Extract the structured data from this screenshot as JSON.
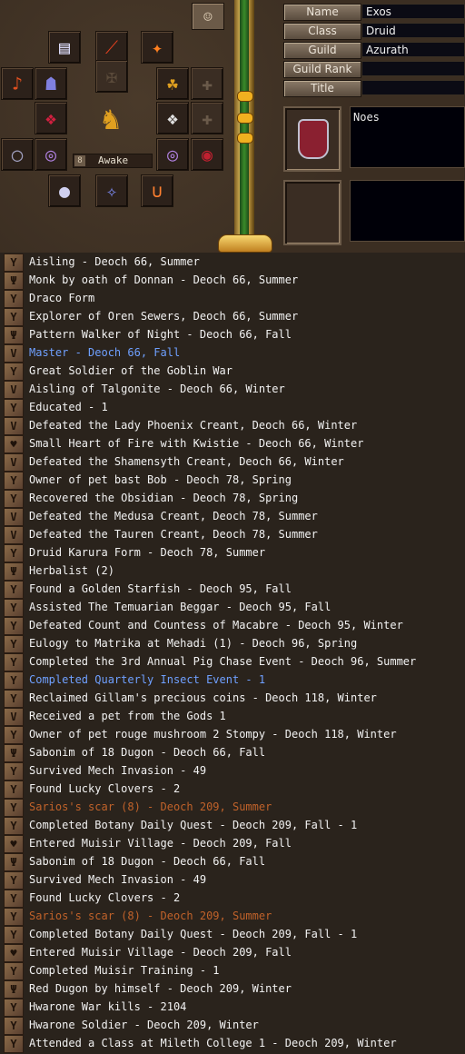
{
  "colors": {
    "white": "#f2f2f2",
    "blue": "#6fa0ff",
    "orange": "#c0622a",
    "label_bg": "#6b5a48",
    "field_bg": "#0b0b14"
  },
  "equipment": {
    "state_number": "8",
    "state_label": "Awake",
    "slots": [
      {
        "icon": "white-armor-icon",
        "glyph": "▤",
        "color": "#e0e0ff"
      },
      {
        "icon": "dagger-icon",
        "glyph": "⟋",
        "color": "#e04020"
      },
      {
        "icon": "flame-staff-icon",
        "glyph": "✦",
        "color": "#ff8020"
      },
      {
        "icon": "red-boot-icon",
        "glyph": "♪",
        "color": "#e05020"
      },
      {
        "icon": "blue-gauntlet-icon",
        "glyph": "☗",
        "color": "#8080e0"
      },
      {
        "icon": "empty-helm-slot-icon",
        "glyph": "✠",
        "color": "#5a4a3a"
      },
      {
        "icon": "fox-companion-icon",
        "glyph": "☘",
        "color": "#e0a020"
      },
      {
        "icon": "empty-ring-slot-icon",
        "glyph": "✚",
        "color": "#6a5a4a"
      },
      {
        "icon": "red-wings-icon",
        "glyph": "❖",
        "color": "#d02040"
      },
      {
        "icon": "white-wings-icon",
        "glyph": "❖",
        "color": "#e0e0e0"
      },
      {
        "icon": "empty-accessory-slot-icon",
        "glyph": "✚",
        "color": "#6a5a4a"
      },
      {
        "icon": "dark-ring-icon",
        "glyph": "◯",
        "color": "#a0a0c0"
      },
      {
        "icon": "purple-bracelet-icon",
        "glyph": "◎",
        "color": "#b080e0"
      },
      {
        "icon": "purple-bracelet-icon",
        "glyph": "◎",
        "color": "#b080e0"
      },
      {
        "icon": "red-gem-ring-icon",
        "glyph": "◉",
        "color": "#c02030"
      },
      {
        "icon": "silver-orb-icon",
        "glyph": "●",
        "color": "#d0d0f0"
      },
      {
        "icon": "small-charm-icon",
        "glyph": "✧",
        "color": "#8090ff"
      },
      {
        "icon": "orange-necklace-icon",
        "glyph": "∪",
        "color": "#ff8030"
      }
    ]
  },
  "profile": {
    "name_label": "Name",
    "name_value": "Exos",
    "class_label": "Class",
    "class_value": "Druid",
    "guild_label": "Guild",
    "guild_value": "Azurath",
    "guild_rank_label": "Guild Rank",
    "guild_rank_value": "",
    "title_label": "Title",
    "title_value": "",
    "message": "Noes",
    "message2": ""
  },
  "legend_marks": [
    {
      "text": "Aisling - Deoch 66, Summer",
      "color": "white",
      "icon": "aisling-mark-icon",
      "glyph": "Y"
    },
    {
      "text": "Monk by oath of Donnan - Deoch 66, Summer",
      "color": "white",
      "icon": "fist-mark-icon",
      "glyph": "Ψ"
    },
    {
      "text": "Draco Form",
      "color": "white",
      "icon": "aisling-mark-icon",
      "glyph": "Y"
    },
    {
      "text": "Explorer of Oren Sewers, Deoch 66, Summer",
      "color": "white",
      "icon": "aisling-mark-icon",
      "glyph": "Y"
    },
    {
      "text": "Pattern Walker of Night - Deoch 66, Fall",
      "color": "white",
      "icon": "fist-mark-icon",
      "glyph": "Ψ"
    },
    {
      "text": "Master - Deoch 66, Fall",
      "color": "blue",
      "icon": "check-mark-icon",
      "glyph": "V"
    },
    {
      "text": "Great Soldier of the Goblin War",
      "color": "white",
      "icon": "aisling-mark-icon",
      "glyph": "Y"
    },
    {
      "text": "Aisling of Talgonite - Deoch 66, Winter",
      "color": "white",
      "icon": "check-mark-icon",
      "glyph": "V"
    },
    {
      "text": "Educated - 1",
      "color": "white",
      "icon": "aisling-mark-icon",
      "glyph": "Y"
    },
    {
      "text": "Defeated the Lady Phoenix Creant, Deoch 66, Winter",
      "color": "white",
      "icon": "check-mark-icon",
      "glyph": "V"
    },
    {
      "text": "Small Heart of Fire with Kwistie - Deoch 66, Winter",
      "color": "white",
      "icon": "heart-mark-icon",
      "glyph": "♥"
    },
    {
      "text": "Defeated the Shamensyth Creant, Deoch 66, Winter",
      "color": "white",
      "icon": "check-mark-icon",
      "glyph": "V"
    },
    {
      "text": "Owner of pet bast Bob - Deoch 78, Spring",
      "color": "white",
      "icon": "aisling-mark-icon",
      "glyph": "Y"
    },
    {
      "text": "Recovered the Obsidian - Deoch 78, Spring",
      "color": "white",
      "icon": "aisling-mark-icon",
      "glyph": "Y"
    },
    {
      "text": "Defeated the Medusa Creant, Deoch 78, Summer",
      "color": "white",
      "icon": "check-mark-icon",
      "glyph": "V"
    },
    {
      "text": "Defeated the Tauren Creant, Deoch 78, Summer",
      "color": "white",
      "icon": "check-mark-icon",
      "glyph": "V"
    },
    {
      "text": "Druid Karura Form - Deoch 78, Summer",
      "color": "white",
      "icon": "aisling-mark-icon",
      "glyph": "Y"
    },
    {
      "text": "Herbalist (2)",
      "color": "white",
      "icon": "fist-mark-icon",
      "glyph": "Ψ"
    },
    {
      "text": "Found a Golden Starfish - Deoch 95, Fall",
      "color": "white",
      "icon": "aisling-mark-icon",
      "glyph": "Y"
    },
    {
      "text": "Assisted The Temuarian Beggar - Deoch 95, Fall",
      "color": "white",
      "icon": "aisling-mark-icon",
      "glyph": "Y"
    },
    {
      "text": "Defeated Count and Countess of Macabre - Deoch 95, Winter",
      "color": "white",
      "icon": "aisling-mark-icon",
      "glyph": "Y"
    },
    {
      "text": "Eulogy to Matrika at Mehadi (1) - Deoch 96, Spring",
      "color": "white",
      "icon": "aisling-mark-icon",
      "glyph": "Y"
    },
    {
      "text": "Completed the 3rd Annual Pig Chase Event - Deoch 96, Summer",
      "color": "white",
      "icon": "aisling-mark-icon",
      "glyph": "Y"
    },
    {
      "text": "Completed Quarterly Insect Event - 1",
      "color": "blue",
      "icon": "aisling-mark-icon",
      "glyph": "Y"
    },
    {
      "text": "Reclaimed Gillam's precious coins - Deoch 118, Winter",
      "color": "white",
      "icon": "aisling-mark-icon",
      "glyph": "Y"
    },
    {
      "text": "Received a pet from the Gods 1",
      "color": "white",
      "icon": "check-mark-icon",
      "glyph": "V"
    },
    {
      "text": "Owner of pet rouge mushroom 2 Stompy - Deoch 118, Winter",
      "color": "white",
      "icon": "aisling-mark-icon",
      "glyph": "Y"
    },
    {
      "text": "Sabonim of 18 Dugon - Deoch 66, Fall",
      "color": "white",
      "icon": "fist-mark-icon",
      "glyph": "Ψ"
    },
    {
      "text": "Survived Mech Invasion - 49",
      "color": "white",
      "icon": "aisling-mark-icon",
      "glyph": "Y"
    },
    {
      "text": "Found Lucky Clovers - 2",
      "color": "white",
      "icon": "aisling-mark-icon",
      "glyph": "Y"
    },
    {
      "text": "Sarios's scar (8) - Deoch 209, Summer",
      "color": "orange",
      "icon": "aisling-mark-icon",
      "glyph": "Y"
    },
    {
      "text": "Completed Botany Daily Quest - Deoch 209, Fall - 1",
      "color": "white",
      "icon": "aisling-mark-icon",
      "glyph": "Y"
    },
    {
      "text": "Entered Muisir Village - Deoch 209, Fall",
      "color": "white",
      "icon": "heart-mark-icon",
      "glyph": "♥"
    },
    {
      "text": "Sabonim of 18 Dugon - Deoch 66, Fall",
      "color": "white",
      "icon": "fist-mark-icon",
      "glyph": "Ψ"
    },
    {
      "text": "Survived Mech Invasion - 49",
      "color": "white",
      "icon": "aisling-mark-icon",
      "glyph": "Y"
    },
    {
      "text": "Found Lucky Clovers - 2",
      "color": "white",
      "icon": "aisling-mark-icon",
      "glyph": "Y"
    },
    {
      "text": "Sarios's scar (8) - Deoch 209, Summer",
      "color": "orange",
      "icon": "aisling-mark-icon",
      "glyph": "Y"
    },
    {
      "text": "Completed Botany Daily Quest - Deoch 209, Fall - 1",
      "color": "white",
      "icon": "aisling-mark-icon",
      "glyph": "Y"
    },
    {
      "text": "Entered Muisir Village - Deoch 209, Fall",
      "color": "white",
      "icon": "heart-mark-icon",
      "glyph": "♥"
    },
    {
      "text": "Completed Muisir Training - 1",
      "color": "white",
      "icon": "aisling-mark-icon",
      "glyph": "Y"
    },
    {
      "text": "Red Dugon by himself - Deoch 209, Winter",
      "color": "white",
      "icon": "fist-mark-icon",
      "glyph": "Ψ"
    },
    {
      "text": "Hwarone War kills - 2104",
      "color": "white",
      "icon": "aisling-mark-icon",
      "glyph": "Y"
    },
    {
      "text": "Hwarone Soldier - Deoch 209, Winter",
      "color": "white",
      "icon": "aisling-mark-icon",
      "glyph": "Y"
    },
    {
      "text": "Attended a Class at Mileth College 1 - Deoch 209, Winter",
      "color": "white",
      "icon": "aisling-mark-icon",
      "glyph": "Y"
    }
  ]
}
